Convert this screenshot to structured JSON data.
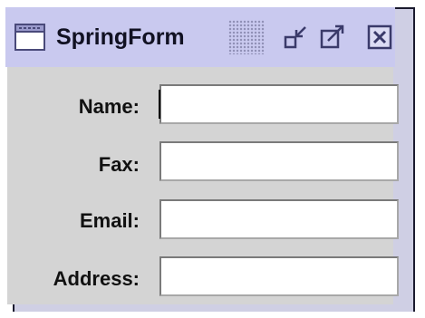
{
  "window": {
    "title": "SpringForm",
    "title_icon": "window-icon",
    "buttons": [
      {
        "name": "iconify-button",
        "icon": "iconify-icon"
      },
      {
        "name": "maximize-button",
        "icon": "maximize-icon"
      },
      {
        "name": "close-button",
        "icon": "close-icon"
      }
    ]
  },
  "form": {
    "name_label": "Name:",
    "name_value": "",
    "fax_label": "Fax:",
    "fax_value": "",
    "email_label": "Email:",
    "email_value": "",
    "address_label": "Address:",
    "address_value": ""
  },
  "colors": {
    "titlebar": "#c9c9ef",
    "content": "#d4d4d4",
    "icon_stroke": "#3a3a6a"
  }
}
